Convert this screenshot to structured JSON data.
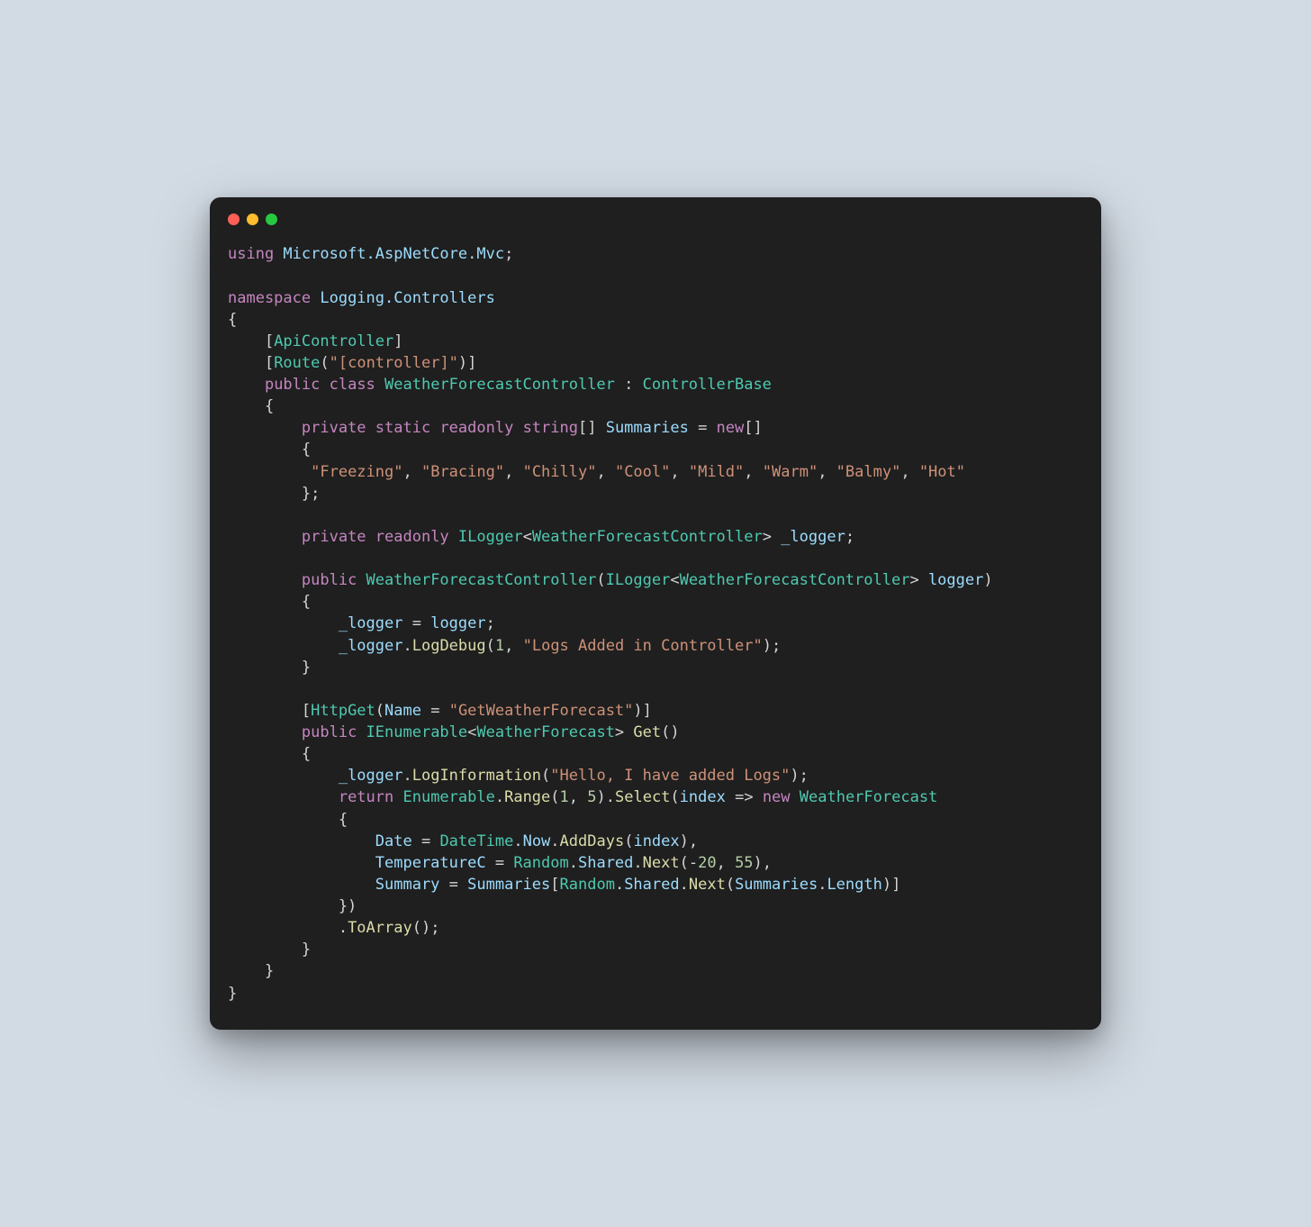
{
  "titlebar": {
    "close": "close",
    "minimize": "minimize",
    "zoom": "zoom"
  },
  "code": {
    "l1_using": "using",
    "l1_ns": " Microsoft.AspNetCore.Mvc",
    "l1_semi": ";",
    "l3_namespace": "namespace",
    "l3_nsname": " Logging.Controllers",
    "l4_brace": "{",
    "l5_indent": "    [",
    "l5_attr": "ApiController",
    "l5_close": "]",
    "l6_indent": "    [",
    "l6_attr": "Route",
    "l6_paren": "(",
    "l6_str": "\"[controller]\"",
    "l6_close": ")]",
    "l7_indent": "    ",
    "l7_public": "public",
    "l7_class": " class",
    "l7_name": " WeatherForecastController",
    "l7_colon": " : ",
    "l7_base": "ControllerBase",
    "l8_brace": "    {",
    "l9_indent": "        ",
    "l9_private": "private",
    "l9_static": " static",
    "l9_readonly": " readonly",
    "l9_string": " string",
    "l9_brackets": "[] ",
    "l9_name": "Summaries",
    "l9_eq": " = ",
    "l9_new": "new",
    "l9_brackets2": "[]",
    "l10_brace": "        {",
    "l11_indent": "         ",
    "l11_s1": "\"Freezing\"",
    "l11_c1": ", ",
    "l11_s2": "\"Bracing\"",
    "l11_c2": ", ",
    "l11_s3": "\"Chilly\"",
    "l11_c3": ", ",
    "l11_s4": "\"Cool\"",
    "l11_c4": ", ",
    "l11_s5": "\"Mild\"",
    "l11_c5": ", ",
    "l11_s6": "\"Warm\"",
    "l11_c6": ", ",
    "l11_s7": "\"Balmy\"",
    "l11_c7": ", ",
    "l11_s8": "\"Hot\"",
    "l12_close": "        };",
    "l14_indent": "        ",
    "l14_private": "private",
    "l14_readonly": " readonly",
    "l14_ilogger": " ILogger",
    "l14_lt": "<",
    "l14_t": "WeatherForecastController",
    "l14_gt": "> ",
    "l14_field": "_logger",
    "l14_semi": ";",
    "l16_indent": "        ",
    "l16_public": "public",
    "l16_ctor": " WeatherForecastController",
    "l16_paren": "(",
    "l16_ilogger": "ILogger",
    "l16_lt": "<",
    "l16_t": "WeatherForecastController",
    "l16_gt": "> ",
    "l16_param": "logger",
    "l16_close": ")",
    "l17_brace": "        {",
    "l18_indent": "            ",
    "l18_field": "_logger",
    "l18_eq": " = ",
    "l18_param": "logger",
    "l18_semi": ";",
    "l19_indent": "            ",
    "l19_field": "_logger",
    "l19_dot": ".",
    "l19_method": "LogDebug",
    "l19_paren": "(",
    "l19_num": "1",
    "l19_comma": ", ",
    "l19_str": "\"Logs Added in Controller\"",
    "l19_close": ");",
    "l20_brace": "        }",
    "l22_indent": "        [",
    "l22_attr": "HttpGet",
    "l22_paren": "(",
    "l22_name": "Name",
    "l22_eq": " = ",
    "l22_str": "\"GetWeatherForecast\"",
    "l22_close": ")]",
    "l23_indent": "        ",
    "l23_public": "public",
    "l23_ienum": " IEnumerable",
    "l23_lt": "<",
    "l23_t": "WeatherForecast",
    "l23_gt": "> ",
    "l23_method": "Get",
    "l23_paren": "()",
    "l24_brace": "        {",
    "l25_indent": "            ",
    "l25_field": "_logger",
    "l25_dot": ".",
    "l25_method": "LogInformation",
    "l25_paren": "(",
    "l25_str": "\"Hello, I have added Logs\"",
    "l25_close": ");",
    "l26_indent": "            ",
    "l26_return": "return",
    "l26_enum": " Enumerable",
    "l26_dot": ".",
    "l26_range": "Range",
    "l26_paren": "(",
    "l26_n1": "1",
    "l26_comma": ", ",
    "l26_n2": "5",
    "l26_close": ").",
    "l26_select": "Select",
    "l26_paren2": "(",
    "l26_index": "index",
    "l26_arrow": " => ",
    "l26_new": "new",
    "l26_type": " WeatherForecast",
    "l27_brace": "            {",
    "l28_indent": "                ",
    "l28_prop": "Date",
    "l28_eq": " = ",
    "l28_dt": "DateTime",
    "l28_dot": ".",
    "l28_now": "Now",
    "l28_dot2": ".",
    "l28_add": "AddDays",
    "l28_paren": "(",
    "l28_idx": "index",
    "l28_close": "),",
    "l29_indent": "                ",
    "l29_prop": "TemperatureC",
    "l29_eq": " = ",
    "l29_rand": "Random",
    "l29_dot": ".",
    "l29_shared": "Shared",
    "l29_dot2": ".",
    "l29_next": "Next",
    "l29_paren": "(-",
    "l29_n1": "20",
    "l29_comma": ", ",
    "l29_n2": "55",
    "l29_close": "),",
    "l30_indent": "                ",
    "l30_prop": "Summary",
    "l30_eq": " = ",
    "l30_sum": "Summaries",
    "l30_br": "[",
    "l30_rand": "Random",
    "l30_dot": ".",
    "l30_shared": "Shared",
    "l30_dot2": ".",
    "l30_next": "Next",
    "l30_paren": "(",
    "l30_sum2": "Summaries",
    "l30_dot3": ".",
    "l30_len": "Length",
    "l30_close": ")]",
    "l31_close": "            })",
    "l32_indent": "            .",
    "l32_toarray": "ToArray",
    "l32_paren": "();",
    "l33_brace": "        }",
    "l34_brace": "    }",
    "l35_brace": "}"
  }
}
